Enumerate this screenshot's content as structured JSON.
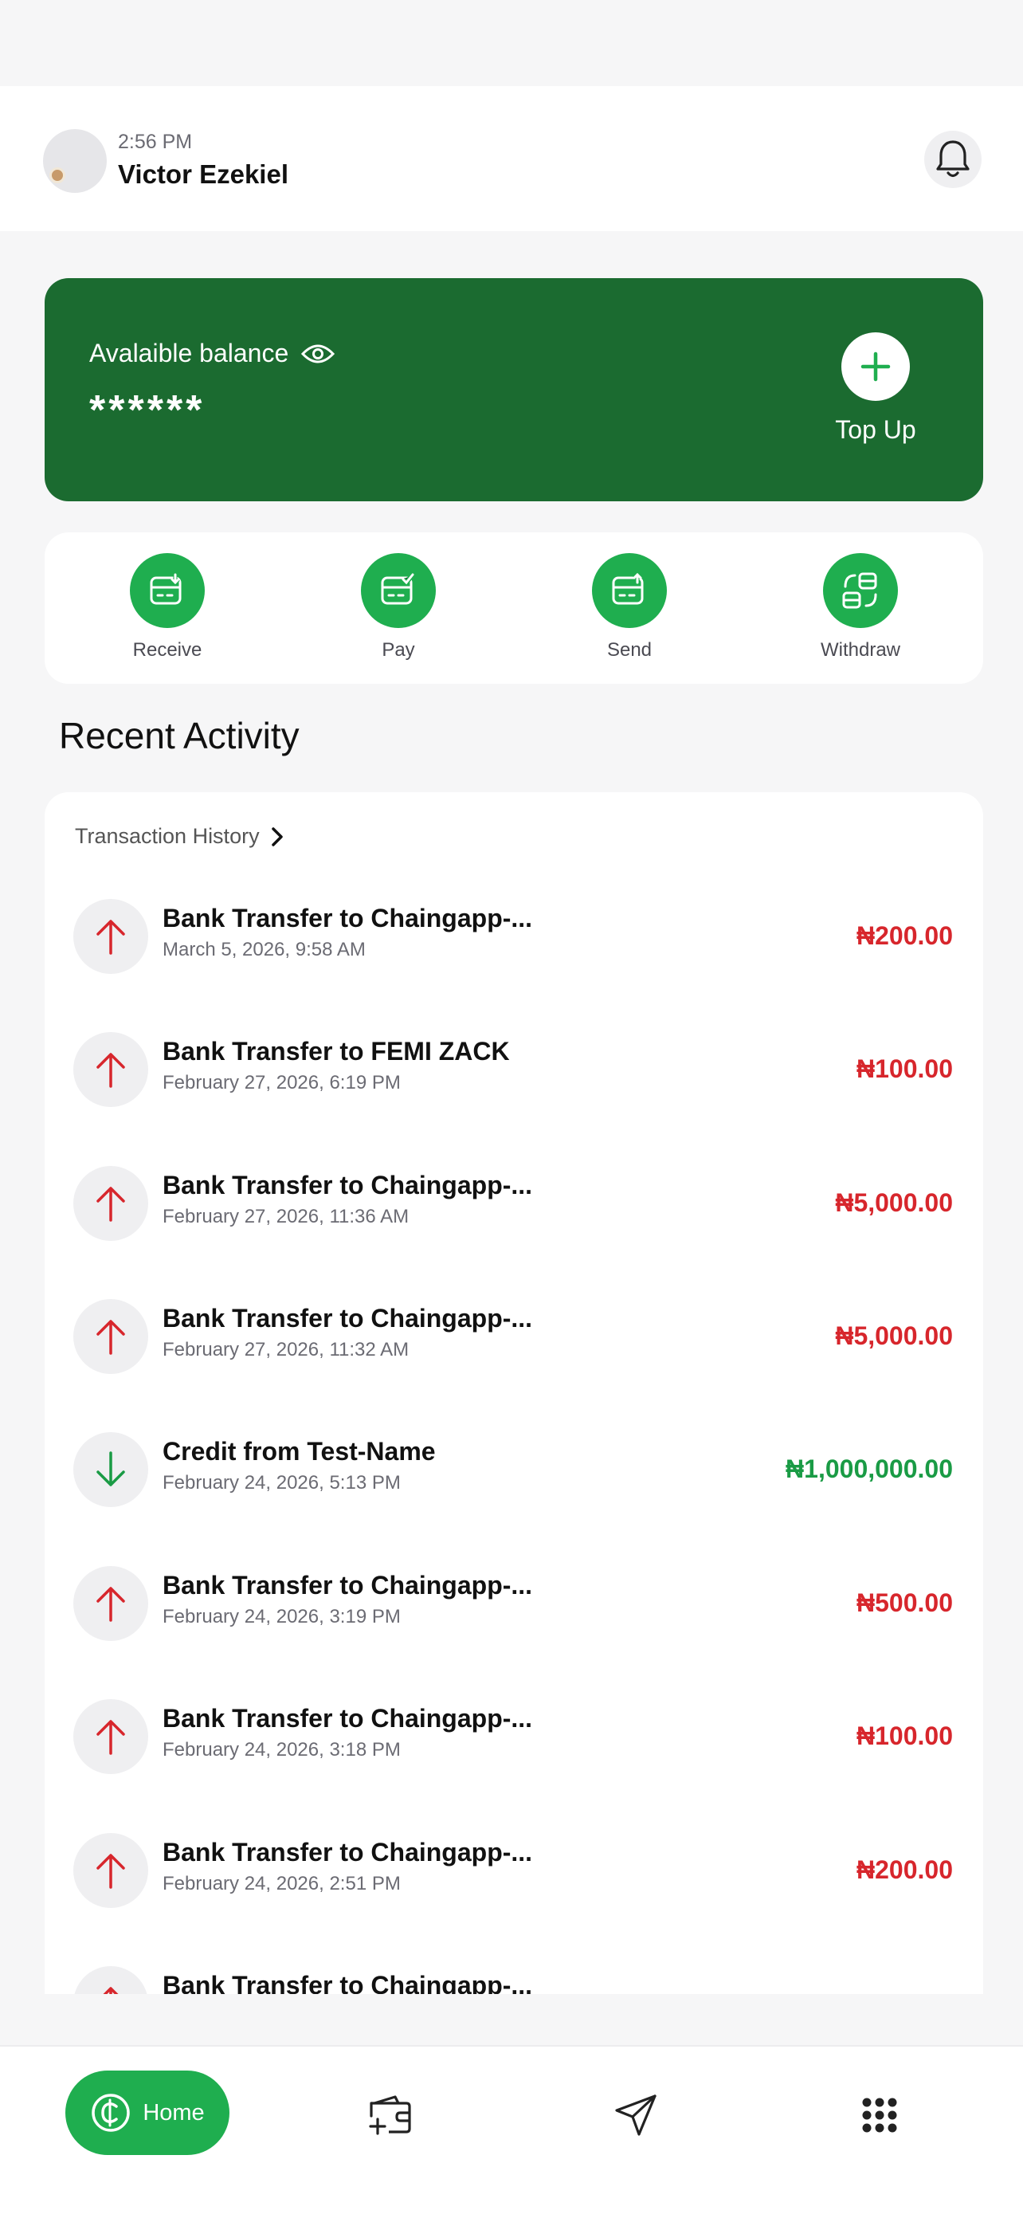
{
  "header": {
    "time": "2:56 PM",
    "user_name": "Victor Ezekiel"
  },
  "balance": {
    "label": "Avalaible balance",
    "value": "******",
    "topup_label": "Top Up"
  },
  "actions": [
    {
      "label": "Receive",
      "icon": "receive-icon"
    },
    {
      "label": "Pay",
      "icon": "pay-icon"
    },
    {
      "label": "Send",
      "icon": "send-icon"
    },
    {
      "label": "Withdraw",
      "icon": "withdraw-icon"
    }
  ],
  "recent": {
    "title": "Recent Activity",
    "history_link": "Transaction History"
  },
  "transactions": [
    {
      "title": "Bank Transfer to Chaingapp-...",
      "date": "March 5, 2026, 9:58 AM",
      "amount": "₦200.00",
      "type": "debit"
    },
    {
      "title": "Bank Transfer to FEMI ZACK",
      "date": "February 27, 2026, 6:19 PM",
      "amount": "₦100.00",
      "type": "debit"
    },
    {
      "title": "Bank Transfer to Chaingapp-...",
      "date": "February 27, 2026, 11:36 AM",
      "amount": "₦5,000.00",
      "type": "debit"
    },
    {
      "title": "Bank Transfer to Chaingapp-...",
      "date": "February 27, 2026, 11:32 AM",
      "amount": "₦5,000.00",
      "type": "debit"
    },
    {
      "title": "Credit from Test-Name",
      "date": "February 24, 2026, 5:13 PM",
      "amount": "₦1,000,000.00",
      "type": "credit"
    },
    {
      "title": "Bank Transfer to Chaingapp-...",
      "date": "February 24, 2026, 3:19 PM",
      "amount": "₦500.00",
      "type": "debit"
    },
    {
      "title": "Bank Transfer to Chaingapp-...",
      "date": "February 24, 2026, 3:18 PM",
      "amount": "₦100.00",
      "type": "debit"
    },
    {
      "title": "Bank Transfer to Chaingapp-...",
      "date": "February 24, 2026, 2:51 PM",
      "amount": "₦200.00",
      "type": "debit"
    },
    {
      "title": "Bank Transfer to Chaingapp-...",
      "date": "",
      "amount": "",
      "type": "debit"
    }
  ],
  "nav": {
    "home_label": "Home",
    "items": [
      "home-icon",
      "wallet-add-icon",
      "send-plane-icon",
      "menu-grid-icon"
    ]
  },
  "colors": {
    "brand_green": "#1b6b30",
    "accent_green": "#1fae4f",
    "debit_red": "#d7262c",
    "credit_green": "#1a9b45"
  }
}
